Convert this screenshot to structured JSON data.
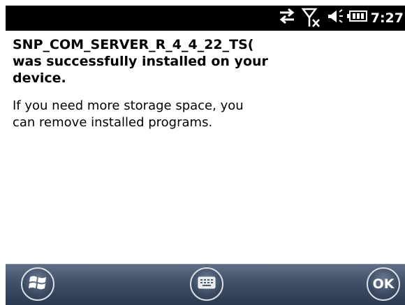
{
  "status_bar": {
    "time": "7:27",
    "icons": [
      "sync-arrows-icon",
      "no-signal-icon",
      "speaker-icon",
      "battery-icon"
    ]
  },
  "message": {
    "title": "SNP_COM_SERVER_R_4_4_22_TS(\nwas successfully installed on your\ndevice.",
    "body": "If you need more storage space, you\ncan remove installed programs."
  },
  "softkeys": {
    "left": "start-icon",
    "center": "keyboard-icon",
    "right_label": "OK"
  },
  "colors": {
    "status_bar_bg": "#000000",
    "softkey_bar_bg": "#3f5068",
    "text": "#000000"
  }
}
